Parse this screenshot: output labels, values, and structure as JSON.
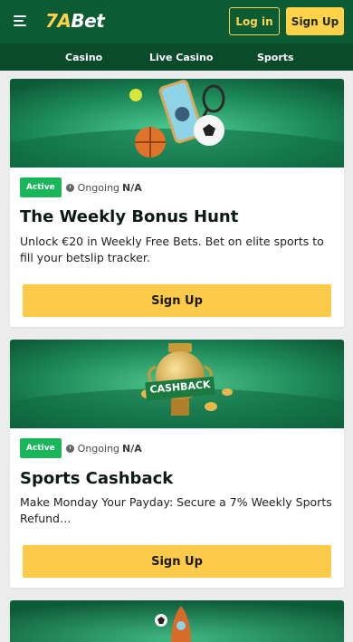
{
  "brand": {
    "logo_num": "7A",
    "logo_word": "Bet"
  },
  "header": {
    "login_label": "Log in",
    "signup_label": "Sign Up"
  },
  "nav": {
    "items": [
      {
        "label": "Casino"
      },
      {
        "label": "Live Casino"
      },
      {
        "label": "Sports"
      }
    ]
  },
  "promotions": [
    {
      "status": "Active",
      "ongoing_label": "Ongoing",
      "ongoing_value": "N/A",
      "title": "The Weekly Bonus Hunt",
      "description": "Unlock €20 in Weekly Free Bets. Bet on elite sports to fill your betslip tracker.",
      "button_label": "Sign Up"
    },
    {
      "status": "Active",
      "ongoing_label": "Ongoing",
      "ongoing_value": "N/A",
      "title": "Sports Cashback",
      "description": "Make Monday Your Payday: Secure a 7% Weekly Sports Refund…",
      "button_label": "Sign Up",
      "banner_text": "CASHBACK"
    }
  ],
  "colors": {
    "header_bg": "#0b5b35",
    "nav_bg": "#0a4b2c",
    "accent_yellow": "#ffd24a",
    "button_yellow": "#fdca4a",
    "active_green": "#1bb55c",
    "page_bg": "#ececec"
  }
}
